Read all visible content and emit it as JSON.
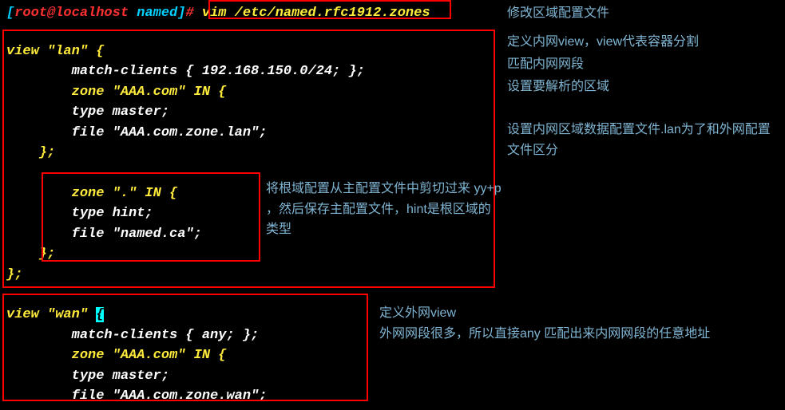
{
  "prompt": {
    "open_bracket": "[",
    "user": "root",
    "at": "@",
    "host": "localhost ",
    "dir": "named",
    "close_bracket": "]",
    "hash": "# "
  },
  "command": "vim /etc/named.rfc1912.zones",
  "lan_block": {
    "l1": "view \"lan\" {",
    "l2": "        match-clients { 192.168.150.0/24; };",
    "l3": "        zone \"AAA.com\" IN {",
    "l4": "        type master;",
    "l5": "        file \"AAA.com.zone.lan\";",
    "l6": "    };",
    "l7": "        zone \".\" IN {",
    "l8": "        type hint;",
    "l9": "        file \"named.ca\";",
    "l10": "    };",
    "l11": "};"
  },
  "wan_block": {
    "l1a": "view \"wan\" ",
    "l1b": "{",
    "l2": "        match-clients { any; };",
    "l3": "        zone \"AAA.com\" IN {",
    "l4": "        type master;",
    "l5": "        file \"AAA.com.zone.wan\";"
  },
  "annotations": {
    "a1": "修改区域配置文件",
    "a2": "定义内网view，view代表容器分割",
    "a3": "匹配内网网段",
    "a4": "设置要解析的区域",
    "a5": "设置内网区域数据配置文件.lan为了和外网配置文件区分",
    "a6": "将根域配置从主配置文件中剪切过来 yy+p ，然后保存主配置文件，hint是根区域的类型",
    "a7": "定义外网view",
    "a8": "外网网段很多，所以直接any 匹配出来内网网段的任意地址"
  }
}
